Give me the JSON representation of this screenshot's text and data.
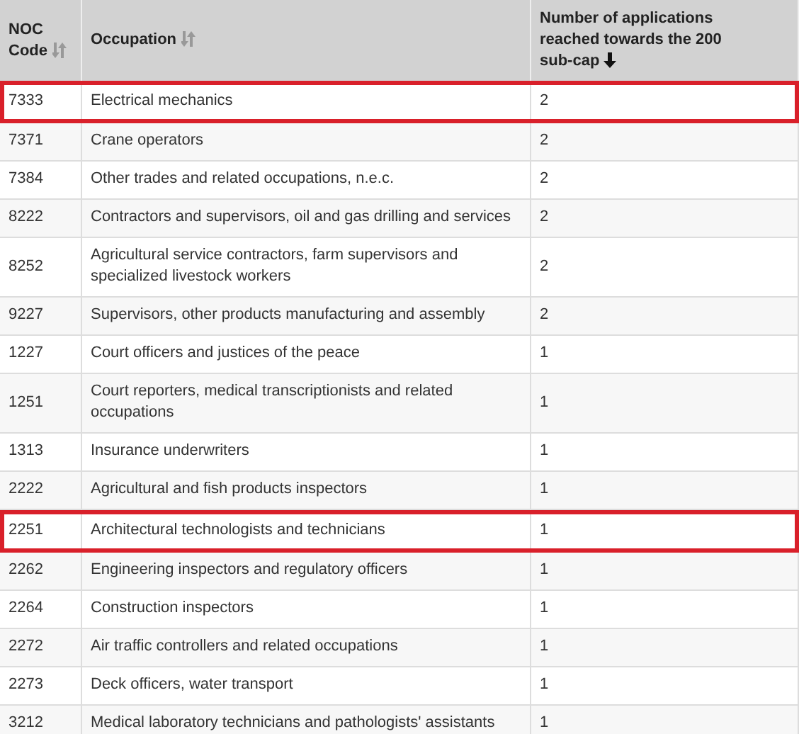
{
  "table": {
    "columns": [
      {
        "label": "NOC Code",
        "sorted": false
      },
      {
        "label": "Occupation",
        "sorted": false
      },
      {
        "label": "Number of applications reached towards the 200 sub-cap",
        "sorted": true
      }
    ],
    "rows": [
      {
        "code": "7333",
        "occupation": "Electrical mechanics",
        "count": "2",
        "highlighted": true
      },
      {
        "code": "7371",
        "occupation": "Crane operators",
        "count": "2",
        "highlighted": false
      },
      {
        "code": "7384",
        "occupation": "Other trades and related occupations, n.e.c.",
        "count": "2",
        "highlighted": false
      },
      {
        "code": "8222",
        "occupation": "Contractors and supervisors, oil and gas drilling and services",
        "count": "2",
        "highlighted": false
      },
      {
        "code": "8252",
        "occupation": "Agricultural service contractors, farm supervisors and specialized livestock workers",
        "count": "2",
        "highlighted": false
      },
      {
        "code": "9227",
        "occupation": "Supervisors, other products manufacturing and assembly",
        "count": "2",
        "highlighted": false
      },
      {
        "code": "1227",
        "occupation": "Court officers and justices of the peace",
        "count": "1",
        "highlighted": false
      },
      {
        "code": "1251",
        "occupation": "Court reporters, medical transcriptionists and related occupations",
        "count": "1",
        "highlighted": false
      },
      {
        "code": "1313",
        "occupation": "Insurance underwriters",
        "count": "1",
        "highlighted": false
      },
      {
        "code": "2222",
        "occupation": "Agricultural and fish products inspectors",
        "count": "1",
        "highlighted": false
      },
      {
        "code": "2251",
        "occupation": "Architectural technologists and technicians",
        "count": "1",
        "highlighted": true
      },
      {
        "code": "2262",
        "occupation": "Engineering inspectors and regulatory officers",
        "count": "1",
        "highlighted": false
      },
      {
        "code": "2264",
        "occupation": "Construction inspectors",
        "count": "1",
        "highlighted": false
      },
      {
        "code": "2272",
        "occupation": "Air traffic controllers and related occupations",
        "count": "1",
        "highlighted": false
      },
      {
        "code": "2273",
        "occupation": "Deck officers, water transport",
        "count": "1",
        "highlighted": false
      },
      {
        "code": "3212",
        "occupation": "Medical laboratory technicians and pathologists' assistants",
        "count": "1",
        "highlighted": false
      }
    ]
  }
}
